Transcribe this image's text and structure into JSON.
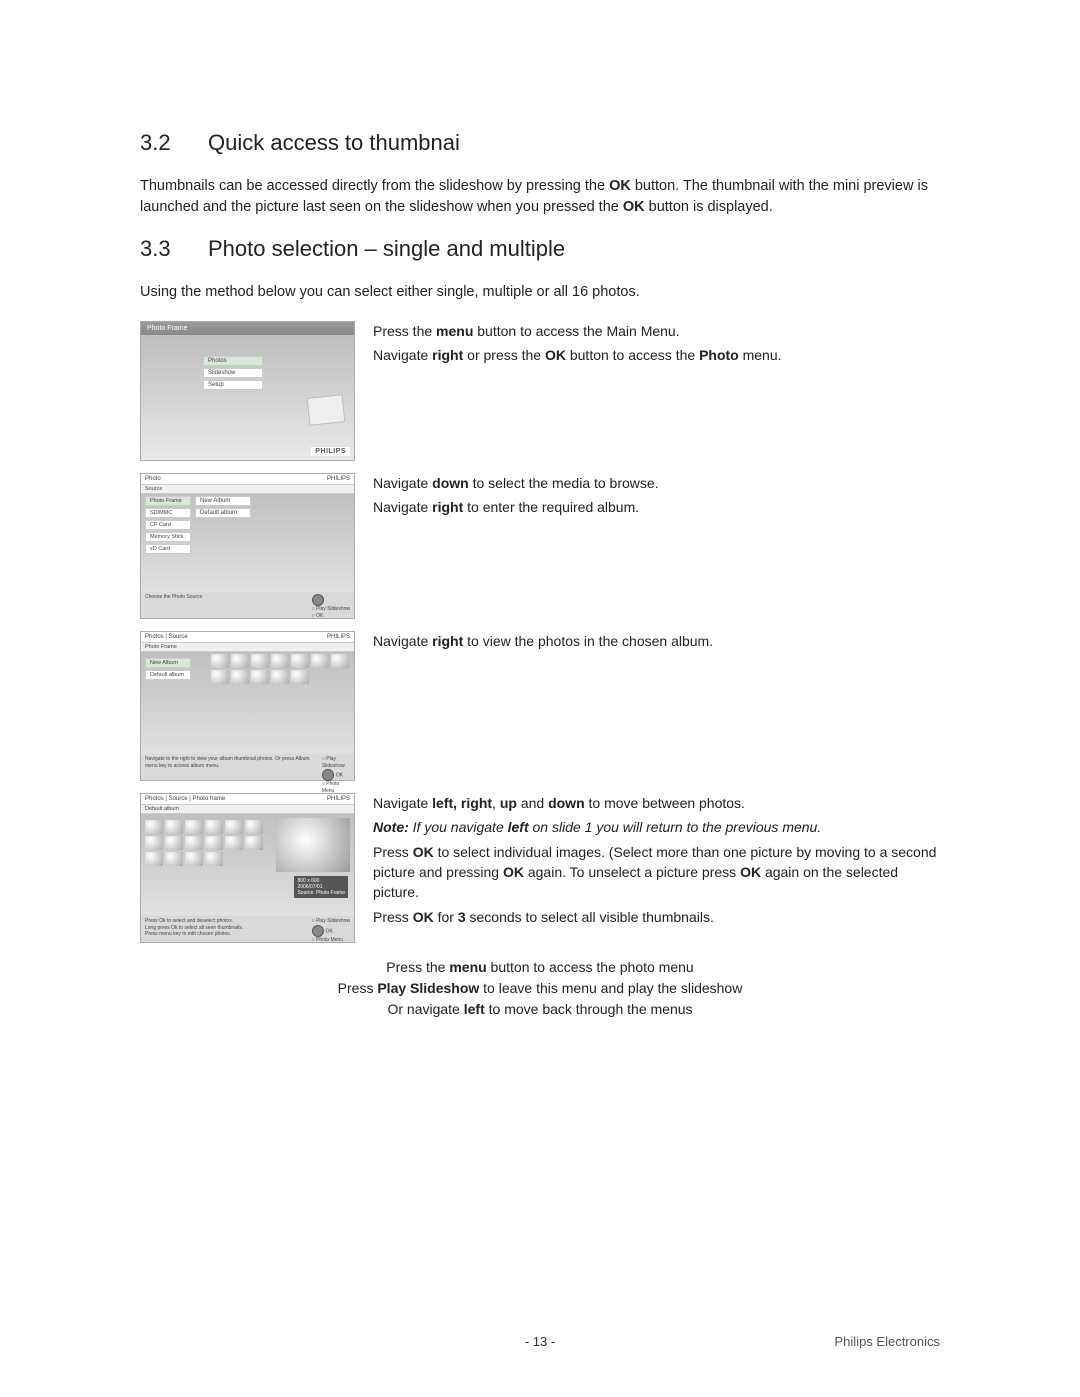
{
  "sections": {
    "s32": {
      "num": "3.2",
      "title": "Quick access to thumbnai"
    },
    "s33": {
      "num": "3.3",
      "title": "Photo selection – single and multiple"
    }
  },
  "para32": {
    "t1": "Thumbnails can be accessed directly from the slideshow by pressing the ",
    "b1": "OK",
    "t2": " button. The thumbnail with the mini preview is launched and the picture last seen on the slideshow when you pressed the ",
    "b2": "OK",
    "t3": " button is displayed."
  },
  "para33_intro": "Using the method below you can select either single, multiple or all 16 photos.",
  "steps": {
    "s1": {
      "l1": {
        "a": "Press the ",
        "b": "menu",
        "c": " button to access the Main Menu."
      },
      "l2": {
        "a": "Navigate ",
        "b": "right",
        "c": " or press the ",
        "d": "OK",
        "e": " button to access the ",
        "f": "Photo",
        "g": " menu."
      }
    },
    "s2": {
      "l1": {
        "a": "Navigate ",
        "b": "down",
        "c": " to select the media to browse."
      },
      "l2": {
        "a": "Navigate ",
        "b": "right",
        "c": " to enter the required album."
      }
    },
    "s3": {
      "l1": {
        "a": "Navigate ",
        "b": "right",
        "c": " to view the photos in the chosen album."
      }
    },
    "s4": {
      "l1": {
        "a": "Navigate ",
        "b": "left, right",
        "c": ", ",
        "d": "up",
        "e": " and ",
        "f": "down",
        "g": " to move between photos."
      },
      "note": {
        "a": "Note:",
        "b": " If you navigate ",
        "c": "left",
        "d": " on slide 1 you will return to the previous menu."
      },
      "l2": {
        "a": "Press ",
        "b": "OK",
        "c": " to select individual images. (Select more than one picture by moving to a second picture and pressing ",
        "d": "OK",
        "e": " again. To unselect a picture press ",
        "f": "OK",
        "g": " again on the selected picture."
      },
      "l3": {
        "a": "Press ",
        "b": "OK",
        "c": " for ",
        "d": "3",
        "e": " seconds to select all visible thumbnails."
      }
    }
  },
  "bottom": {
    "l1": {
      "a": "Press the ",
      "b": "menu",
      "c": " button to access the photo menu"
    },
    "l2": {
      "a": "Press ",
      "b": "Play Slideshow",
      "c": " to leave this menu and play the slideshow"
    },
    "l3": {
      "a": "Or navigate ",
      "b": "left",
      "c": " to move back through the menus"
    }
  },
  "footer": {
    "page": "- 13 -",
    "brand": "Philips Electronics"
  },
  "ui": {
    "brand": "PHILIPS",
    "frameTitle": "Photo Frame",
    "mainMenu": {
      "photos": "Photos",
      "slideshow": "Slideshow",
      "setup": "Setup"
    },
    "photoHdr": "Photo",
    "sourceHdr": "Source",
    "sources": {
      "pf": "Photo Frame",
      "sd": "SD/MMC",
      "cf": "CF Card",
      "ms": "Memory Stick",
      "xd": "xD Card"
    },
    "albums": {
      "new": "New Album",
      "def": "Default album"
    },
    "bc3": "Photos | Source",
    "bc4": "Photos | Source | Photo frame",
    "hints": {
      "choose": "Choose the Photo Source",
      "navView": "Navigate to the right to view your album thumbnail photos. Or press Album menu key to access album menu.",
      "pressOk": "Press Ok to select and deselect photos.",
      "longOk": "Long press Ok to select all seen thumbnails.",
      "menuKey": "Press menu key to edit chosen photos.",
      "play": "Play Slideshow",
      "ok": "OK",
      "pmenu": "Photo Menu"
    },
    "metadata": {
      "res": "800 x 600",
      "date": "2006/07/01",
      "src": "Source: Photo Frame"
    }
  }
}
